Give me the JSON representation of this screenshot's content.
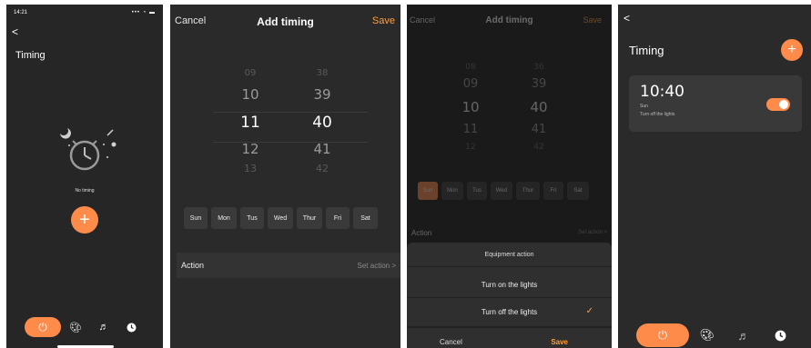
{
  "accent": "#ff8b4a",
  "screen1": {
    "status_time": "14:21",
    "status_icons": "••• ◔ ▬",
    "back": "<",
    "title": "Timing",
    "empty_text": "No timing",
    "add": "+",
    "tabs": [
      "power-icon",
      "palette-icon",
      "music-icon",
      "clock-icon"
    ]
  },
  "screen2": {
    "cancel": "Cancel",
    "title": "Add timing",
    "save": "Save",
    "hours": [
      "09",
      "10",
      "11",
      "12",
      "13"
    ],
    "minutes": [
      "38",
      "39",
      "40",
      "41",
      "42"
    ],
    "days": [
      "Sun",
      "Mon",
      "Tus",
      "Wed",
      "Thur",
      "Fri",
      "Sat"
    ],
    "action_label": "Action",
    "action_value": "Set action >"
  },
  "screen3": {
    "cancel": "Cancel",
    "title": "Add timing",
    "save": "Save",
    "hours": [
      "08",
      "09",
      "10",
      "11",
      "12"
    ],
    "minutes": [
      "36",
      "39",
      "40",
      "41",
      "42"
    ],
    "days": [
      "Sun",
      "Mon",
      "Tus",
      "Wed",
      "Thur",
      "Fri",
      "Sat"
    ],
    "action_label": "Action",
    "action_value": "Set action >",
    "sheet_title": "Equipment action",
    "option_on": "Turn on the lights",
    "option_off": "Turn off the lights",
    "sheet_cancel": "Cancel",
    "sheet_save": "Save"
  },
  "screen4": {
    "back": "<",
    "title": "Timing",
    "add": "+",
    "timer_time": "10:40",
    "timer_day": "Sun",
    "timer_action": "Turn off the lights",
    "timer_enabled": true
  }
}
